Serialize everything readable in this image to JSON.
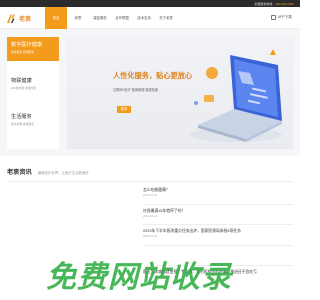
{
  "topbar": {
    "hotline_label": "全国服务热线：",
    "hotline_number": "400-000-0000"
  },
  "header": {
    "logo_text": "老衷",
    "nav": [
      {
        "label": "首页",
        "active": true
      },
      {
        "label": "老衷"
      },
      {
        "label": "康复服务"
      },
      {
        "label": "合作联盟"
      },
      {
        "label": "技术支持"
      },
      {
        "label": "关于老衷"
      }
    ],
    "app_label": "APP下载"
  },
  "sidebar": {
    "items": [
      {
        "title": "数字医疗健康",
        "subtitle": "家庭医养 养老服务"
      },
      {
        "title": "物联健康",
        "subtitle": "24h监护器 健康监测"
      },
      {
        "title": "生活服务",
        "subtitle": "居家护理 健康知识"
      }
    ]
  },
  "banner": {
    "title": "人性化服务，贴心更放心",
    "subtitle": "互联网+医疗 慢病管理 健康档案",
    "button": "更多"
  },
  "news": {
    "title": "老衷资讯",
    "description": "播新医疗世界，让医疗生活更美好",
    "items": [
      {
        "title": "怎么吃能健康？",
        "date": "2024-04-24"
      },
      {
        "title": "社保缴满15年就停了吗？",
        "date": "2024-04-24"
      },
      {
        "title": "2023年下半年医改重点任务出炉，国家医保局承担8项任务",
        "date": "2023-07-27"
      },
      {
        "title": "",
        "date": ""
      },
      {
        "title": "前五步求病情就变预？专家称：是利医利民的好事，推进还不会吃亏",
        "date": ""
      }
    ]
  },
  "watermark": {
    "text": "免费网站收录"
  },
  "colors": {
    "accent": "#f29b1c",
    "watermark": "#28aa3c"
  }
}
